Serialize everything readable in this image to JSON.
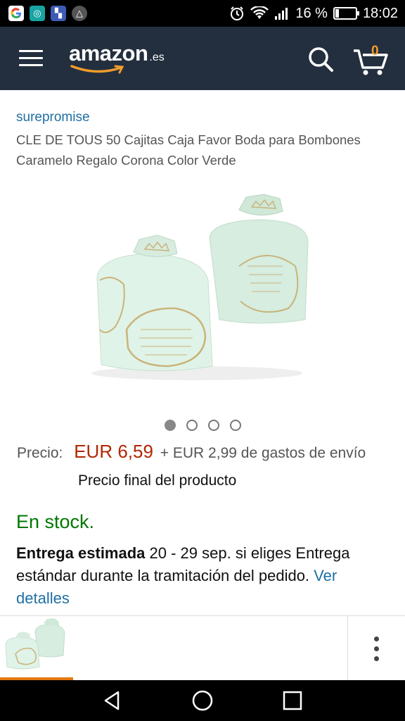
{
  "status_bar": {
    "battery_percent": "16 %",
    "time": "18:02",
    "icons": [
      "google-icon",
      "app-icon",
      "photo-icon",
      "drive-icon",
      "alarm-icon",
      "wifi-icon",
      "signal-icon",
      "battery-icon"
    ]
  },
  "header": {
    "logo_text": "amazon",
    "logo_tld": ".es",
    "cart_count": "0",
    "colors": {
      "background": "#232f3e",
      "accent": "#f39c2c"
    }
  },
  "product": {
    "brand": "surepromise",
    "title": "CLE DE TOUS 50 Cajitas Caja Favor Boda para Bombones Caramelo Regalo Corona Color Verde",
    "image_count": 4,
    "active_image_index": 0
  },
  "price": {
    "label": "Precio:",
    "value": "EUR 6,59",
    "shipping": "+ EUR 2,99 de gastos de envío",
    "final_note": "Precio final del producto",
    "price_color": "#b12704"
  },
  "availability": {
    "status": "En stock.",
    "status_color": "#007600"
  },
  "delivery": {
    "label": "Entrega estimada",
    "text": " 20 - 29 sep. si eliges Entrega estándar durante la tramitación del pedido. ",
    "link": "Ver detalles"
  }
}
